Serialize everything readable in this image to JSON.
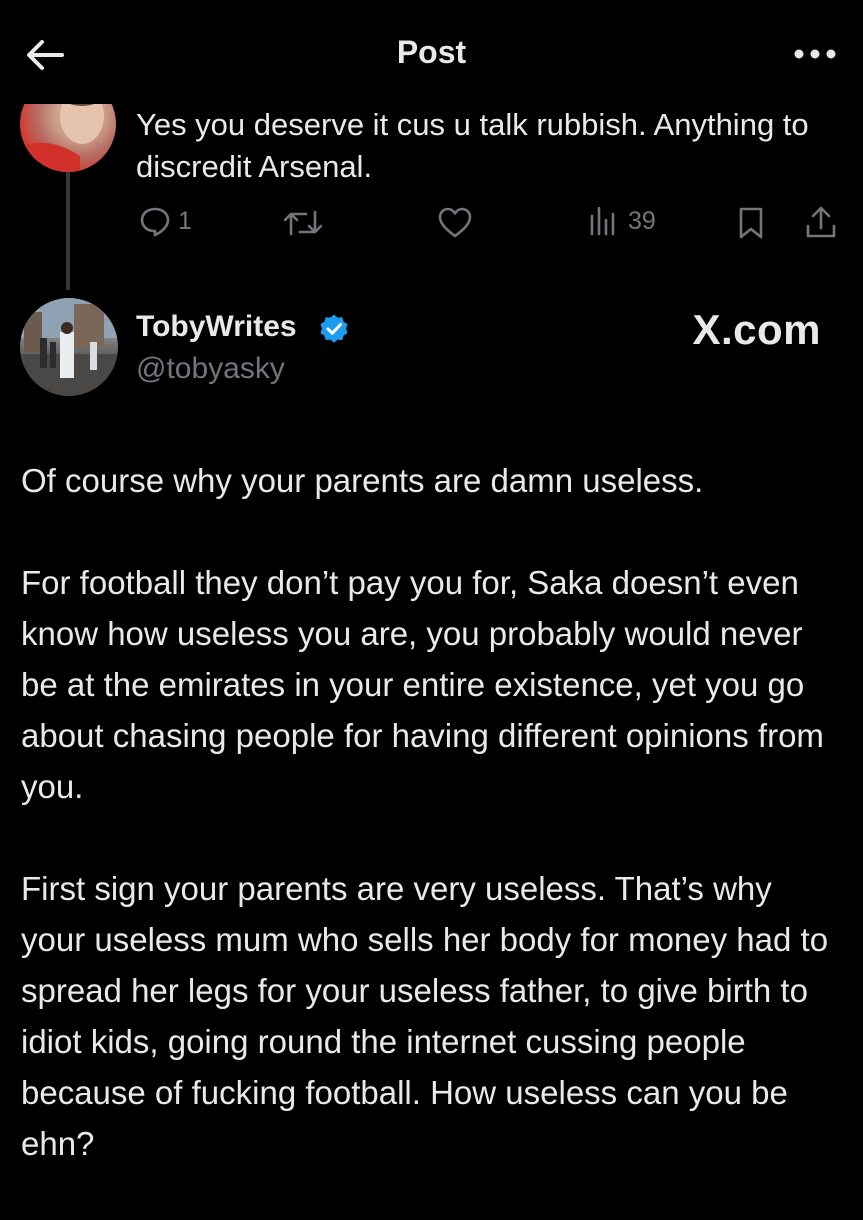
{
  "header": {
    "title": "Post",
    "back_icon": "arrow-left-icon",
    "more_icon": "more-horizontal-icon"
  },
  "parent_post": {
    "text": "Yes you deserve it cus u talk rubbish. Anything to discredit Arsenal.",
    "actions": {
      "reply_count": "1",
      "views_count": "39"
    }
  },
  "main_post": {
    "display_name": "TobyWrites",
    "handle": "@tobyasky",
    "verified": true,
    "paragraphs": [
      "Of course why your parents are damn useless.",
      "For football they don’t pay you for, Saka doesn’t even know how useless you are, you probably would never be at the emirates in your entire existence, yet you go about chasing people for having different opinions from you.",
      "First sign your parents are very useless. That’s why your useless mum who sells her body for money had to spread her legs for your useless father, to give birth to idiot kids, going round the internet cussing people because of fucking football. How useless can you be ehn?"
    ]
  },
  "watermark": "X.com",
  "colors": {
    "background": "#000000",
    "text_primary": "#e7e9ea",
    "text_secondary": "#71767b",
    "verified_badge": "#1d9bf0",
    "thread_line": "#333639"
  }
}
